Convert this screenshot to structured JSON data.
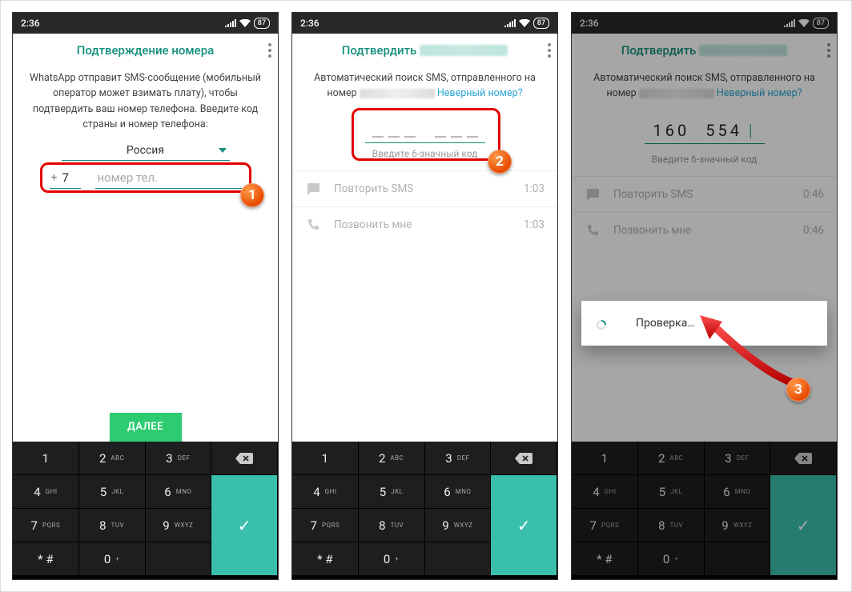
{
  "statusbar": {
    "time": "2:36",
    "battery": "87"
  },
  "colors": {
    "teal": "#148f7d",
    "green_btn": "#2ecc71",
    "check_key": "#3bbfad",
    "badge": "#e84a00"
  },
  "phone1": {
    "title": "Подтверждение номера",
    "desc": "WhatsApp отправит SMS-сообщение (мобильный оператор может взимать плату), чтобы подтвердить ваш номер телефона. Введите код страны и номер телефона:",
    "country": "Россия",
    "cc_plus": "+",
    "cc_value": "7",
    "phone_placeholder": "номер тел.",
    "next": "ДАЛЕЕ",
    "badge": "1"
  },
  "phone2": {
    "title_prefix": "Подтвердить",
    "desc_prefix": "Автоматический поиск SMS, отправленного на номер",
    "wrong_link": "Неверный номер?",
    "hint": "Введите 6-значный код",
    "rows": {
      "resend": {
        "label": "Повторить SMS",
        "time": "1:03"
      },
      "call": {
        "label": "Позвонить мне",
        "time": "1:03"
      }
    },
    "badge": "2"
  },
  "phone3": {
    "title_prefix": "Подтвердить",
    "desc_prefix": "Автоматический поиск SMS, отправленного на номер",
    "wrong_link": "Неверный номер?",
    "code_a": "160",
    "code_b": "554",
    "hint": "Введите 6-значный код",
    "rows": {
      "resend": {
        "label": "Повторить SMS",
        "time": "0:46"
      },
      "call": {
        "label": "Позвонить мне",
        "time": "0:46"
      }
    },
    "dialog": "Проверка…",
    "badge": "3"
  },
  "keypad": {
    "k1": "1",
    "k2": "2",
    "k3": "3",
    "k4": "4",
    "k5": "5",
    "k6": "6",
    "k7": "7",
    "k8": "8",
    "k9": "9",
    "k0": "0",
    "s2": "ABC",
    "s3": "DEF",
    "s4": "GHI",
    "s5": "JKL",
    "s6": "MNO",
    "s7": "PQRS",
    "s8": "TUV",
    "s9": "WXYZ",
    "s0": "+",
    "sym": "* #",
    "check": "✓"
  }
}
